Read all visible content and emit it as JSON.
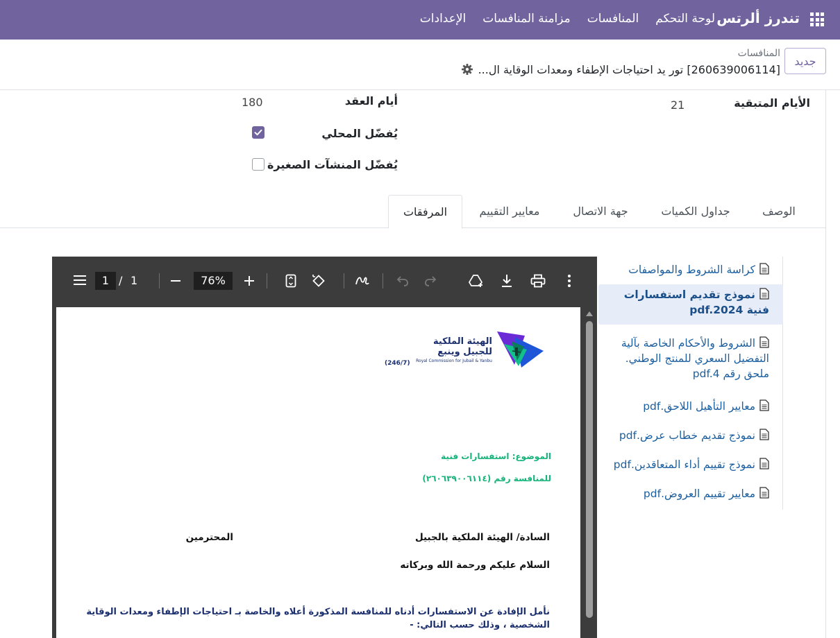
{
  "navbar": {
    "brand": "تندرز ألرتس",
    "menu": [
      "لوحة التحكم",
      "المنافسات",
      "مزامنة المنافسات",
      "الإعدادات"
    ]
  },
  "control_panel": {
    "new_button": "جديد",
    "breadcrumb_parent": "المنافسات",
    "record_title": "[260639006114] تور يد احتياجات الإطفاء ومعدات الوقاية ال..."
  },
  "form": {
    "remaining_days_label": "الأيام المتبقية",
    "remaining_days_value": "21",
    "contract_days_label": "أيام العقد",
    "contract_days_value": "180",
    "local_pref_label": "يُفضّل المحلي",
    "local_pref_checked": true,
    "sme_pref_label": "يُفضّل المنشآت الصغيرة",
    "sme_pref_checked": false
  },
  "tabs": [
    "الوصف",
    "جداول الكميات",
    "جهة الاتصال",
    "معايير التقييم",
    "المرفقات"
  ],
  "active_tab": "المرفقات",
  "attachments": [
    {
      "name": "كراسة الشروط والمواصفات",
      "selected": false
    },
    {
      "name": "نموذج تقديم استفسارات فنية pdf.2024",
      "selected": true
    },
    {
      "name": "الشروط والأحكام الخاصة بآلية التفضيل السعري للمنتج الوطني. ملحق رقم pdf.4",
      "selected": false
    },
    {
      "name": "معايير التأهيل اللاحق.pdf",
      "selected": false
    },
    {
      "name": "نموذج تقديم خطاب عرض.pdf",
      "selected": false
    },
    {
      "name": "نموذج تقييم أداء المتعاقدين.pdf",
      "selected": false
    },
    {
      "name": "معايير تقييم العروض.pdf",
      "selected": false
    }
  ],
  "pdf_viewer": {
    "current_page": "1",
    "page_separator": "/",
    "total_pages": "1",
    "zoom": "76%",
    "icons": [
      "menu-icon",
      "zoom-out-icon",
      "zoom-in-icon",
      "fit-page-icon",
      "rotate-icon",
      "annotate-icon",
      "undo-icon",
      "redo-icon",
      "add-to-drive-icon",
      "download-icon",
      "print-icon",
      "more-icon"
    ]
  },
  "pdf_document": {
    "org_name_line1": "الهيئة الملكية",
    "org_name_line2": "للجبيل وينبع",
    "org_name_en": "Royal Commission for Jubail & Yanbu",
    "form_number": "(246/7)",
    "subject": "الموضوع: استفسارات فنية",
    "tender_ref": "للمنافسة رقم (٢٦٠٦٣٩٠٠٦١١٤)",
    "addressee": "السادة/ الهيئة الملكية بالجبيل",
    "honorific": "المحترمين",
    "greeting": "السلام عليكم ورحمة الله وبركاته",
    "body_line1": "نأمل الإفادة عن الاستفسارات أدناه للمنافسة المذكورة أعلاه  والخاصة بـ احتياجات الإطفاء ومعدات الوقاية",
    "body_line2": "الشخصية ، وذلك حسب التالي: -"
  },
  "colors": {
    "navbar": "#71639e",
    "link": "#1b5fa0",
    "selected_bg": "#e6edf8",
    "pdf_green": "#16b37a",
    "pdf_navy": "#1b2f6e"
  }
}
